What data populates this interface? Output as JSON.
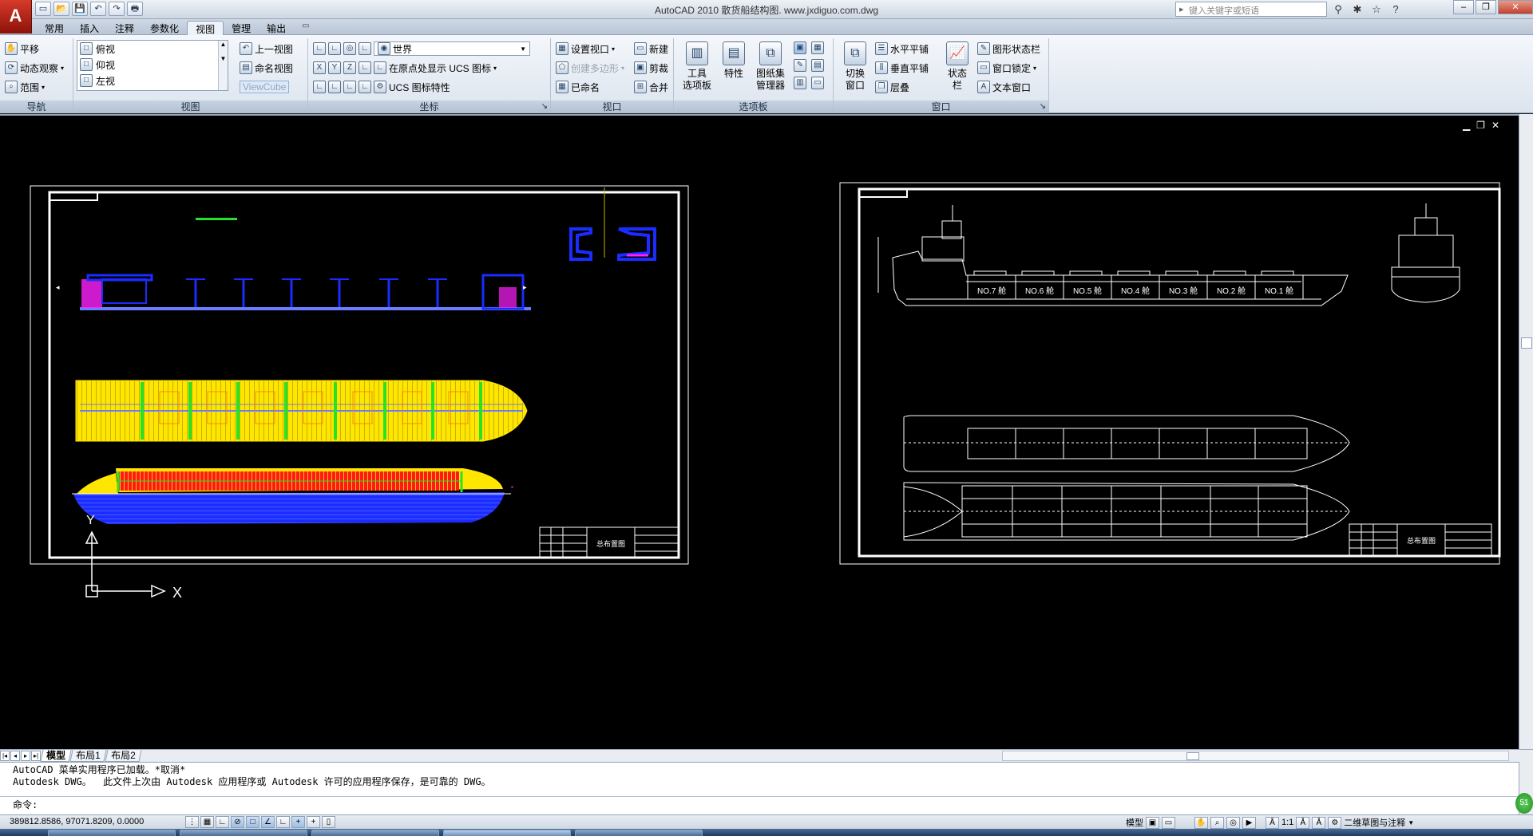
{
  "window": {
    "title": "AutoCAD 2010      散货船结构图. www.jxdiguo.com.dwg",
    "search_placeholder": "键入关键字或短语",
    "controls": [
      "–",
      "❐",
      "✕"
    ]
  },
  "app_button": "A",
  "quick_access": [
    "▭",
    "📂",
    "💾",
    "↶",
    "↷",
    "🖶"
  ],
  "search_tools": [
    "⚲",
    "✱",
    "☆",
    "?"
  ],
  "tabs": [
    "常用",
    "插入",
    "注释",
    "参数化",
    "视图",
    "管理",
    "输出",
    "▭"
  ],
  "active_tab": "视图",
  "ribbon": {
    "nav": {
      "label": "导航",
      "items": [
        "平移",
        "动态观察",
        "范围"
      ]
    },
    "views": {
      "label": "视图",
      "list": [
        "俯视",
        "仰视",
        "左视"
      ],
      "prev_view": "上一视图",
      "named_view": "命名视图",
      "viewcube": "ViewCube"
    },
    "ucs": {
      "label": "坐标",
      "world": "世界",
      "show_origin": "在原点处显示 UCS 图标",
      "ucs_props": "UCS 图标特性"
    },
    "viewport": {
      "label": "视口",
      "setup": "设置视口",
      "create_poly": "创建多边形",
      "named": "已命名",
      "new": "新建",
      "clip": "剪裁",
      "join": "合并"
    },
    "palettes": {
      "label": "选项板",
      "tools": "工具\n选项板",
      "props": "特性",
      "sheetset": "图纸集\n管理器"
    },
    "window": {
      "label": "窗口",
      "switch": "切换\n窗口",
      "tile_h": "水平平铺",
      "tile_v": "垂直平铺",
      "cascade": "层叠",
      "status": "状态\n栏",
      "graphic_status": "图形状态栏",
      "lock": "窗口锁定",
      "text_win": "文本窗口"
    }
  },
  "drawing": {
    "left_sheet_title": "总布置图",
    "right_sheet_title": "总布置图",
    "hold_labels": [
      "NO.7 舱",
      "NO.6 舱",
      "NO.5 舱",
      "NO.4 舱",
      "NO.3 舱",
      "NO.2 舱",
      "NO.1 舱"
    ],
    "ucs_x": "X",
    "ucs_y": "Y",
    "doc_controls": [
      "▁",
      "❐",
      "✕"
    ]
  },
  "layout_tabs": [
    "模型",
    "布局1",
    "布局2"
  ],
  "active_layout": "模型",
  "command": {
    "line1": "AutoCAD 菜单实用程序已加载。*取消*",
    "line2": "Autodesk DWG。  此文件上次由 Autodesk 应用程序或 Autodesk 许可的应用程序保存，是可靠的 DWG。",
    "prompt": "命令:"
  },
  "status": {
    "coords": "389812.8586, 97071.8209, 0.0000",
    "model": "模型",
    "scale": "1:1",
    "workspace": "二维草图与注释",
    "globe": "51"
  },
  "colors": {
    "yellow": "#ffe600",
    "blue": "#1a2cff",
    "red": "#ff1a1a",
    "green": "#27e327",
    "magenta": "#ff20ff",
    "white": "#ffffff"
  }
}
